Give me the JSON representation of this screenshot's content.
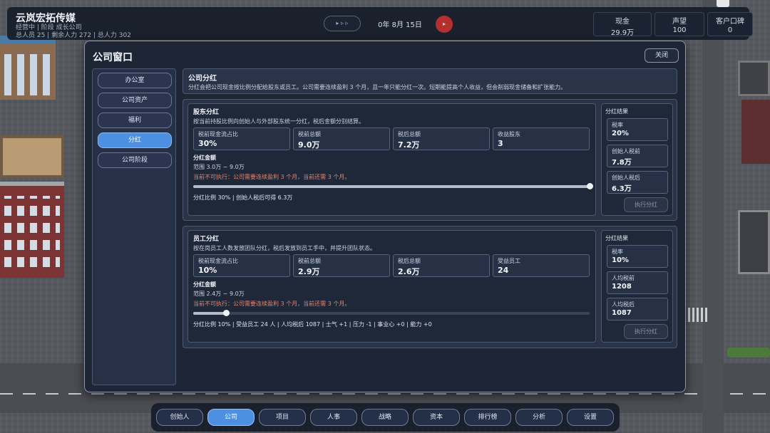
{
  "hud": {
    "company_name": "云岚宏拓传媒",
    "status_line": "经营中 | 阶段 成长公司",
    "stats_line": "总人员 25 | 剩余人力 272 | 总人力 302",
    "speed_label": "▸ ▹ ▹",
    "date": "0年 8月 15日",
    "pause_label": "▸",
    "cash_label": "现金",
    "cash_value": "29.9万",
    "reputation_label": "声望",
    "reputation_value": "100",
    "client_label": "客户口碑",
    "client_value": "0"
  },
  "window": {
    "title": "公司窗口",
    "close_label": "关闭",
    "nav": [
      {
        "label": "办公室"
      },
      {
        "label": "公司资产"
      },
      {
        "label": "福利"
      },
      {
        "label": "分红",
        "active": true
      },
      {
        "label": "公司阶段"
      }
    ],
    "header": {
      "title": "公司分红",
      "desc": "分红会把公司现金按比例分配给股东或员工。公司需要连续盈利 3 个月，且一年只能分红一次。短期能提高个人收益，但会削弱现金储备和扩张能力。"
    },
    "shareholder": {
      "title": "股东分红",
      "desc": "按当前持股比例向创始人与外部股东统一分红，税后金额分别结算。",
      "kpis": [
        {
          "label": "税前现金流占比",
          "value": "30%"
        },
        {
          "label": "税前总额",
          "value": "9.0万"
        },
        {
          "label": "税后总额",
          "value": "7.2万"
        },
        {
          "label": "收益股东",
          "value": "3"
        }
      ],
      "amount_title": "分红金额",
      "range": "范围 3.0万 ~ 9.0万",
      "warning": "当前不可执行：公司需要连续盈利 3 个月，当前还需 3 个月。",
      "slider_level": 1.0,
      "summary": "分红比例 30% | 创始人税后可得 6.3万",
      "result_title": "分红结果",
      "results": [
        {
          "label": "税率",
          "value": "20%"
        },
        {
          "label": "创始人税前",
          "value": "7.8万"
        },
        {
          "label": "创始人税后",
          "value": "6.3万"
        }
      ],
      "exec_label": "执行分红"
    },
    "employee": {
      "title": "员工分红",
      "desc": "按在岗员工人数发放团队分红，税后发放到员工手中，并提升团队状态。",
      "kpis": [
        {
          "label": "税前现金流占比",
          "value": "10%"
        },
        {
          "label": "税前总额",
          "value": "2.9万"
        },
        {
          "label": "税后总额",
          "value": "2.6万"
        },
        {
          "label": "受益员工",
          "value": "24"
        }
      ],
      "amount_title": "分红金额",
      "range": "范围 2.4万 ~ 9.0万",
      "warning": "当前不可执行：公司需要连续盈利 3 个月，当前还需 3 个月。",
      "slider_level": 0.083,
      "summary": "分红比例 10% | 受益员工 24 人 | 人均税后 1087 | 士气 +1 | 压力 -1 | 事业心 +0 | 能力 +0",
      "result_title": "分红结果",
      "results": [
        {
          "label": "税率",
          "value": "10%"
        },
        {
          "label": "人均税前",
          "value": "1208"
        },
        {
          "label": "人均税后",
          "value": "1087"
        }
      ],
      "exec_label": "执行分红"
    }
  },
  "bottom_nav": [
    {
      "label": "创始人"
    },
    {
      "label": "公司",
      "active": true
    },
    {
      "label": "项目"
    },
    {
      "label": "人事"
    },
    {
      "label": "战略"
    },
    {
      "label": "资本"
    },
    {
      "label": "排行榜"
    },
    {
      "label": "分析"
    },
    {
      "label": "设置"
    }
  ]
}
